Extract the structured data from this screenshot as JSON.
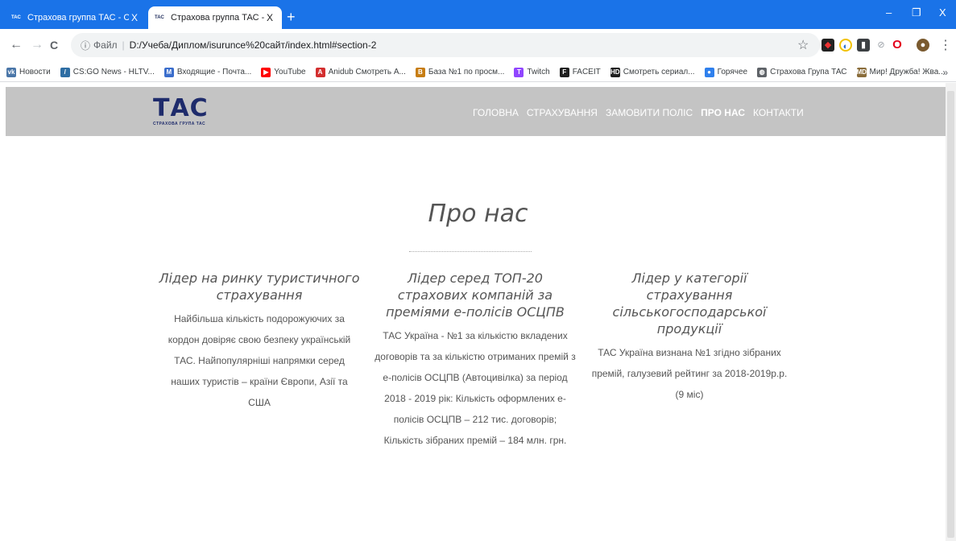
{
  "browser": {
    "tabs": [
      {
        "favicon": "TAC",
        "title": "Страхова группа ТАС - СГ ТАС",
        "close": "X",
        "active": false
      },
      {
        "favicon": "TAC",
        "title": "Страхова группа ТАС - СГ ТАС",
        "close": "X",
        "active": true
      }
    ],
    "new_tab": "+",
    "window_controls": {
      "minimize": "–",
      "restore": "❐",
      "close": "X"
    },
    "nav": {
      "back": "←",
      "forward": "→",
      "reload": "C"
    },
    "address": {
      "info_icon": "ⓘ",
      "file_label": "Файл",
      "url": "D:/Учеба/Диплом/isurunce%20сайт/index.html#section-2"
    },
    "star": "☆",
    "extensions_more": "⋮",
    "bookmarks": [
      {
        "label": "Новости",
        "icon": "vk-icon",
        "color": "#4a76a8",
        "glyph": "vk"
      },
      {
        "label": "CS:GO News - HLTV...",
        "icon": "hltv-icon",
        "color": "#2d6da3",
        "glyph": "/"
      },
      {
        "label": "Входящие - Почта...",
        "icon": "mail-icon",
        "color": "#3b6ecc",
        "glyph": "M"
      },
      {
        "label": "YouTube",
        "icon": "youtube-icon",
        "color": "#ff0000",
        "glyph": "▶"
      },
      {
        "label": "Anidub Смотреть А...",
        "icon": "anidub-icon",
        "color": "#d32f2f",
        "glyph": "A"
      },
      {
        "label": "База №1 по просм...",
        "icon": "baza-icon",
        "color": "#c77d12",
        "glyph": "B"
      },
      {
        "label": "Twitch",
        "icon": "twitch-icon",
        "color": "#9146ff",
        "glyph": "T"
      },
      {
        "label": "FACEIT",
        "icon": "faceit-icon",
        "color": "#1f1f1f",
        "glyph": "F"
      },
      {
        "label": "Смотреть сериал...",
        "icon": "hd-icon",
        "color": "#1f1f1f",
        "glyph": "HD"
      },
      {
        "label": "Горячее",
        "icon": "hot-icon",
        "color": "#2f80ed",
        "glyph": "●"
      },
      {
        "label": "Страхова Група ТАС",
        "icon": "globe-icon",
        "color": "#5f6368",
        "glyph": "◍"
      },
      {
        "label": "Мир! Дружба! Жва...",
        "icon": "md-icon",
        "color": "#8a6d3b",
        "glyph": "MD"
      }
    ],
    "bookmarks_more": "»"
  },
  "site": {
    "logo": {
      "word": "ТАС",
      "subtitle": "СТРАХОВА ГРУПА ТАС"
    },
    "menu": [
      {
        "label": "ГОЛОВНА",
        "active": false
      },
      {
        "label": "СТРАХУВАННЯ",
        "active": false
      },
      {
        "label": "ЗАМОВИТИ ПОЛІС",
        "active": false
      },
      {
        "label": "ПРО НАС",
        "active": true
      },
      {
        "label": "КОНТАКТИ",
        "active": false
      }
    ],
    "section_title": "Про нас",
    "columns": [
      {
        "heading": "Лідер на ринку туристичного страхування",
        "text": "Найбільша кількість подорожуючих за кордон довіряє свою безпеку українській ТАС. Найпопулярніші напрямки серед наших туристів – країни Європи, Азії та США"
      },
      {
        "heading": "Лідер серед ТОП-20 страхових компаній за преміями е-полісів ОСЦПВ",
        "text": "ТАС Україна - №1 за кількістю вкладених договорів та за кількістю отриманих премій з е-полісів ОСЦПВ (Автоцивілка) за період 2018 - 2019 рік: Кількість оформлених е-полісів ОСЦПВ – 212 тис. договорів; Кількість зібраних премій – 184 млн. грн."
      },
      {
        "heading": "Лідер у категорії страхування сільськогосподарської продукції",
        "text": "ТАС Україна визнана №1 згідно зібраних премій, галузевий рейтинг за 2018-2019р.р.(9 міс)"
      }
    ]
  },
  "colors": {
    "chrome_blue": "#1a73e8",
    "nav_gray": "#c4c4c4",
    "logo_navy": "#1e2b6b"
  }
}
